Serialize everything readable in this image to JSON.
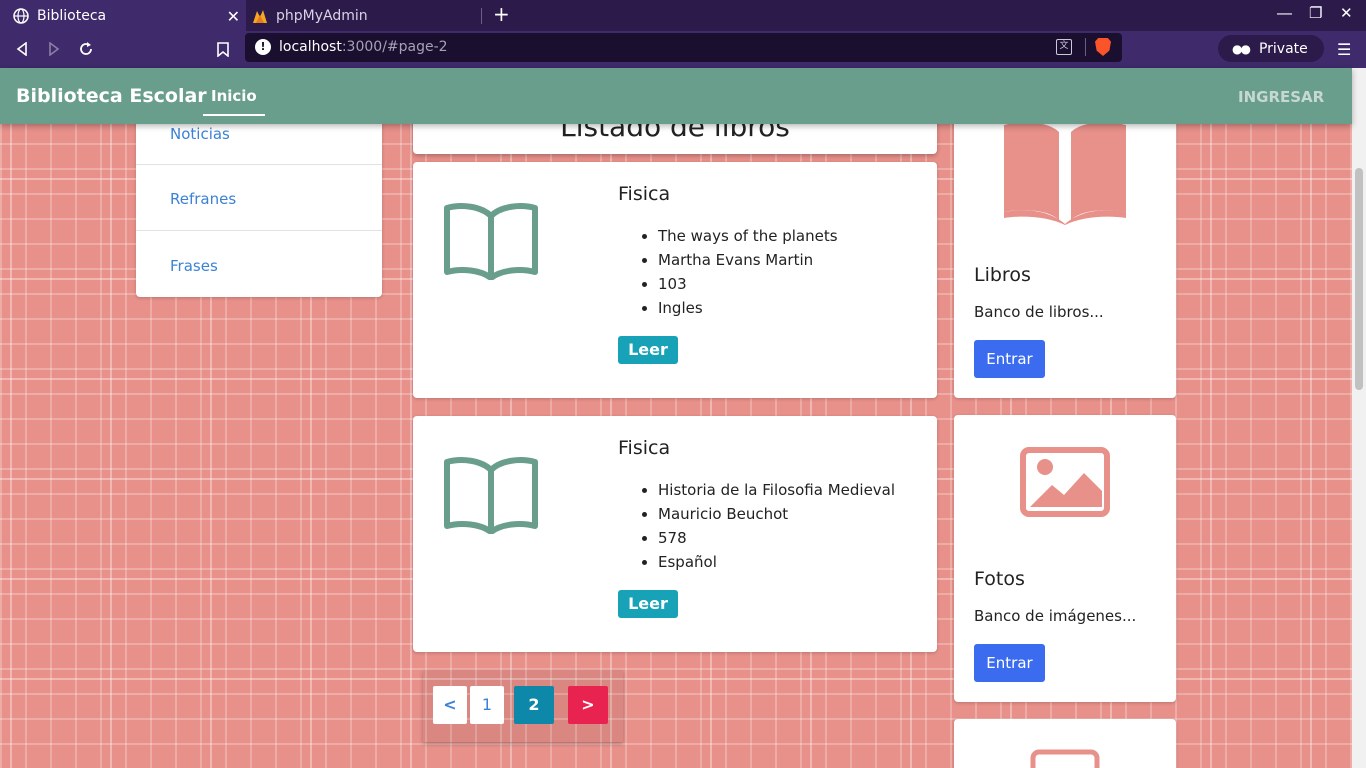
{
  "browser": {
    "tabs": [
      {
        "title": "Biblioteca",
        "active": true,
        "icon": "globe-icon"
      },
      {
        "title": "phpMyAdmin",
        "active": false,
        "icon": "phpmyadmin-icon"
      }
    ],
    "url_host": "localhost",
    "url_rest": ":3000/#page-2",
    "private_label": "Private"
  },
  "site": {
    "brand": "Biblioteca Escolar",
    "nav_inicio": "Inicio",
    "nav_ingresar": "INGRESAR"
  },
  "sidebar": {
    "items": [
      {
        "label": "Noticias"
      },
      {
        "label": "Refranes"
      },
      {
        "label": "Frases"
      }
    ]
  },
  "main": {
    "heading": "Listado de libros",
    "books": [
      {
        "category": "Fisica",
        "title": "The ways of the planets",
        "author": "Martha Evans Martin",
        "pages": "103",
        "language": "Ingles",
        "action": "Leer"
      },
      {
        "category": "Fisica",
        "title": "Historia de la Filosofia Medieval",
        "author": "Mauricio Beuchot",
        "pages": "578",
        "language": "Español",
        "action": "Leer"
      }
    ],
    "pagination": {
      "prev": "<",
      "page1": "1",
      "page2": "2",
      "next": ">",
      "current": 2
    }
  },
  "side_cards": [
    {
      "title": "Libros",
      "text": "Banco de libros...",
      "button": "Entrar",
      "icon": "book-icon"
    },
    {
      "title": "Fotos",
      "text": "Banco de imágenes...",
      "button": "Entrar",
      "icon": "image-icon"
    }
  ],
  "colors": {
    "nav": "#6a9e8c",
    "accent_book": "#6a9e8c",
    "side_icon": "#e8908a",
    "leer_button": "#17a2b8",
    "entrar_button": "#3b6cf0"
  }
}
